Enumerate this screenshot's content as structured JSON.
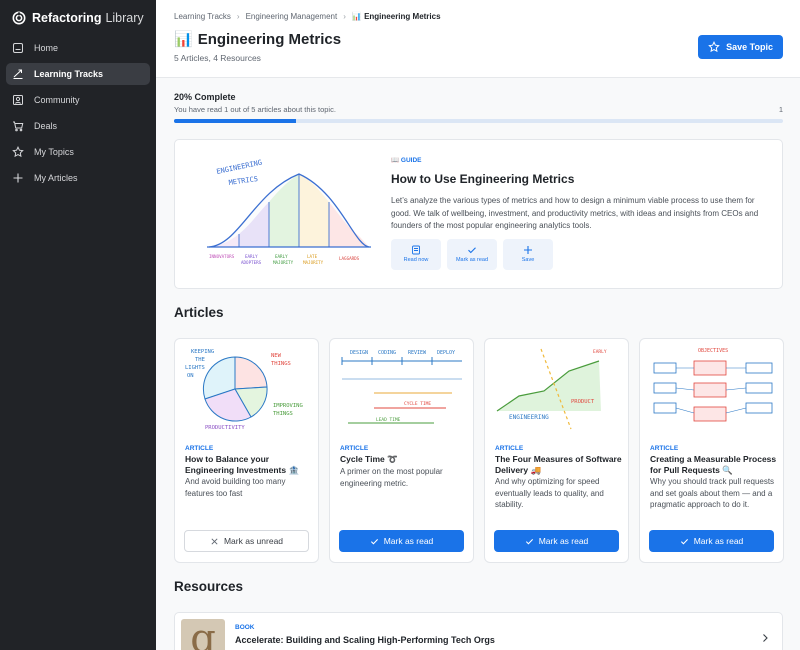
{
  "sidebar": {
    "brand_bold": "Refactoring",
    "brand_light": "Library",
    "items": [
      {
        "label": "Home"
      },
      {
        "label": "Learning Tracks"
      },
      {
        "label": "Community"
      },
      {
        "label": "Deals"
      },
      {
        "label": "My Topics"
      },
      {
        "label": "My Articles"
      }
    ]
  },
  "breadcrumb": [
    "Learning Tracks",
    "Engineering Management",
    "📊 Engineering Metrics"
  ],
  "header": {
    "title_emoji": "📊",
    "title": "Engineering Metrics",
    "subtitle": "5 Articles, 4 Resources",
    "save_label": "Save Topic"
  },
  "progress": {
    "label": "20% Complete",
    "detail": "You have read 1 out of 5 articles about this topic.",
    "count": "1",
    "fraction": 0.2
  },
  "guide": {
    "tag": "📖 GUIDE",
    "title": "How to Use Engineering Metrics",
    "description": "Let’s analyze the various types of metrics and how to design a minimum viable process to use them for good. We talk of wellbeing, investment, and productivity metrics, with ideas and insights from CEOs and founders of the most popular engineering analytics tools.",
    "actions": [
      "Read now",
      "Mark as read",
      "Save"
    ],
    "illustration": {
      "title": "ENGINEERING METRICS",
      "segments": [
        "INNOVATORS",
        "EARLY ADOPTERS",
        "EARLY MAJORITY",
        "LATE MAJORITY",
        "LAGGARDS"
      ]
    }
  },
  "articles_title": "Articles",
  "articles": [
    {
      "tag": "ARTICLE",
      "title": "How to Balance your Engineering Investments 🏦",
      "description": "And avoid building too many features too fast",
      "button": "Mark as unread",
      "read": true,
      "sketch": [
        "KEEPING THE LIGHTS ON",
        "NEW THINGS",
        "IMPROVING THINGS",
        "PRODUCTIVITY"
      ]
    },
    {
      "tag": "ARTICLE",
      "title": "Cycle Time ➰",
      "description": "A primer on the most popular engineering metric.",
      "button": "Mark as read",
      "read": false,
      "sketch": [
        "DESIGN",
        "CODING",
        "REVIEW",
        "DEPLOY",
        "CYCLE TIME",
        "LEAD TIME"
      ]
    },
    {
      "tag": "ARTICLE",
      "title": "The Four Measures of Software Delivery 🚚",
      "description": "And why optimizing for speed eventually leads to quality, and stability.",
      "button": "Mark as read",
      "read": false,
      "sketch": [
        "EARLY IMPROVEMENTS",
        "PRODUCT",
        "ENGINEERING"
      ]
    },
    {
      "tag": "ARTICLE",
      "title": "Creating a Measurable Process for Pull Requests 🔍",
      "description": "Why you should track pull requests and set goals about them — and a pragmatic approach to do it.",
      "button": "Mark as read",
      "read": false,
      "sketch": [
        "OBJECTIVES",
        "KEEP PR CYCLE SHORT",
        "REDUCE CODE REVIEW BACKLOG",
        "AVOID BUILDING WHAT WE DON'T NEED"
      ]
    }
  ],
  "resources_title": "Resources",
  "resources": [
    {
      "tag": "BOOK",
      "title": "Accelerate: Building and Scaling High-Performing Tech Orgs",
      "thumb_letter": "g"
    }
  ],
  "colors": {
    "accent": "#1a73e8",
    "sidebar_bg": "#212327",
    "progress_track": "#dbe6f5"
  }
}
